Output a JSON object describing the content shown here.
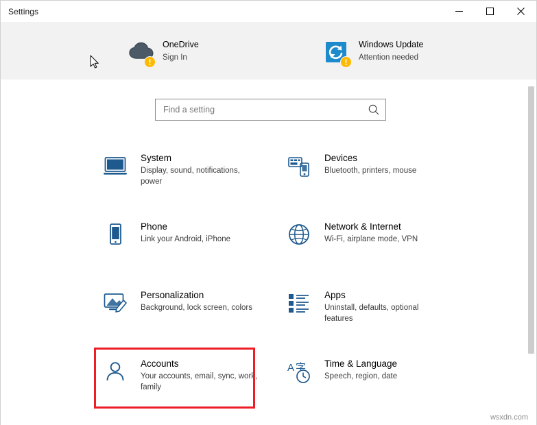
{
  "window": {
    "title": "Settings",
    "minimize_label": "Minimize",
    "maximize_label": "Maximize",
    "close_label": "Close"
  },
  "banner": {
    "items": [
      {
        "icon": "onedrive-cloud-icon",
        "title": "OneDrive",
        "subtitle": "Sign In",
        "badge": "!"
      },
      {
        "icon": "windows-update-sync-icon",
        "title": "Windows Update",
        "subtitle": "Attention needed",
        "badge": "!"
      }
    ]
  },
  "search": {
    "placeholder": "Find a setting",
    "value": "",
    "icon": "search-icon"
  },
  "settings": {
    "tiles": [
      {
        "icon": "monitor-icon",
        "title": "System",
        "subtitle": "Display, sound, notifications, power"
      },
      {
        "icon": "devices-icon",
        "title": "Devices",
        "subtitle": "Bluetooth, printers, mouse"
      },
      {
        "icon": "phone-icon",
        "title": "Phone",
        "subtitle": "Link your Android, iPhone"
      },
      {
        "icon": "globe-icon",
        "title": "Network & Internet",
        "subtitle": "Wi-Fi, airplane mode, VPN"
      },
      {
        "icon": "personalization-brush-icon",
        "title": "Personalization",
        "subtitle": "Background, lock screen, colors"
      },
      {
        "icon": "apps-list-icon",
        "title": "Apps",
        "subtitle": "Uninstall, defaults, optional features"
      },
      {
        "icon": "person-icon",
        "title": "Accounts",
        "subtitle": "Your accounts, email, sync, work, family"
      },
      {
        "icon": "time-language-icon",
        "title": "Time & Language",
        "subtitle": "Speech, region, date"
      }
    ],
    "highlight_index": 6,
    "highlight_color": "#ee1c25"
  },
  "watermark": "wsxdn.com"
}
